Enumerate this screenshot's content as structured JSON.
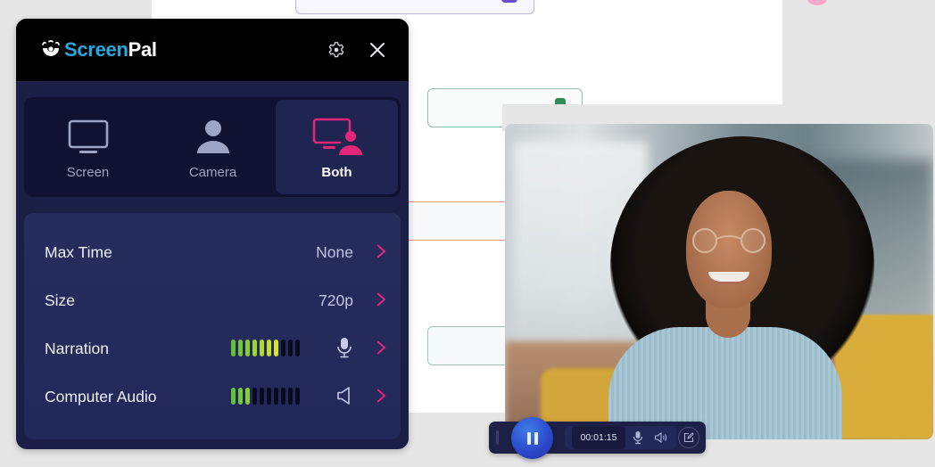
{
  "app": {
    "brand_part1": "Screen",
    "brand_part2": "Pal",
    "header_icons": [
      "gear-icon",
      "close-icon"
    ]
  },
  "colors": {
    "brand_blue": "#2aa7df",
    "accent_pink": "#e3267a",
    "panel_bg": "#1b1f45",
    "meter_green": "#5fc33a",
    "meter_yellow": "#d8e232",
    "record_blue": "#2a46c9"
  },
  "modes": [
    {
      "label": "Screen",
      "icon": "monitor-icon",
      "selected": false
    },
    {
      "label": "Camera",
      "icon": "person-icon",
      "selected": false
    },
    {
      "label": "Both",
      "icon": "monitor-person-icon",
      "selected": true
    }
  ],
  "settings": [
    {
      "label": "Max Time",
      "value": "None"
    },
    {
      "label": "Size",
      "value": "720p"
    },
    {
      "label": "Narration",
      "meter_level": 7,
      "meter_segments": 10,
      "icon": "microphone-icon"
    },
    {
      "label": "Computer Audio",
      "meter_level": 3,
      "meter_segments": 10,
      "icon": "speaker-icon"
    }
  ],
  "recording_bar": {
    "state": "recording",
    "elapsed": "00:01:15",
    "controls": [
      "pause-icon",
      "microphone-icon",
      "speaker-icon",
      "edit-icon"
    ]
  }
}
